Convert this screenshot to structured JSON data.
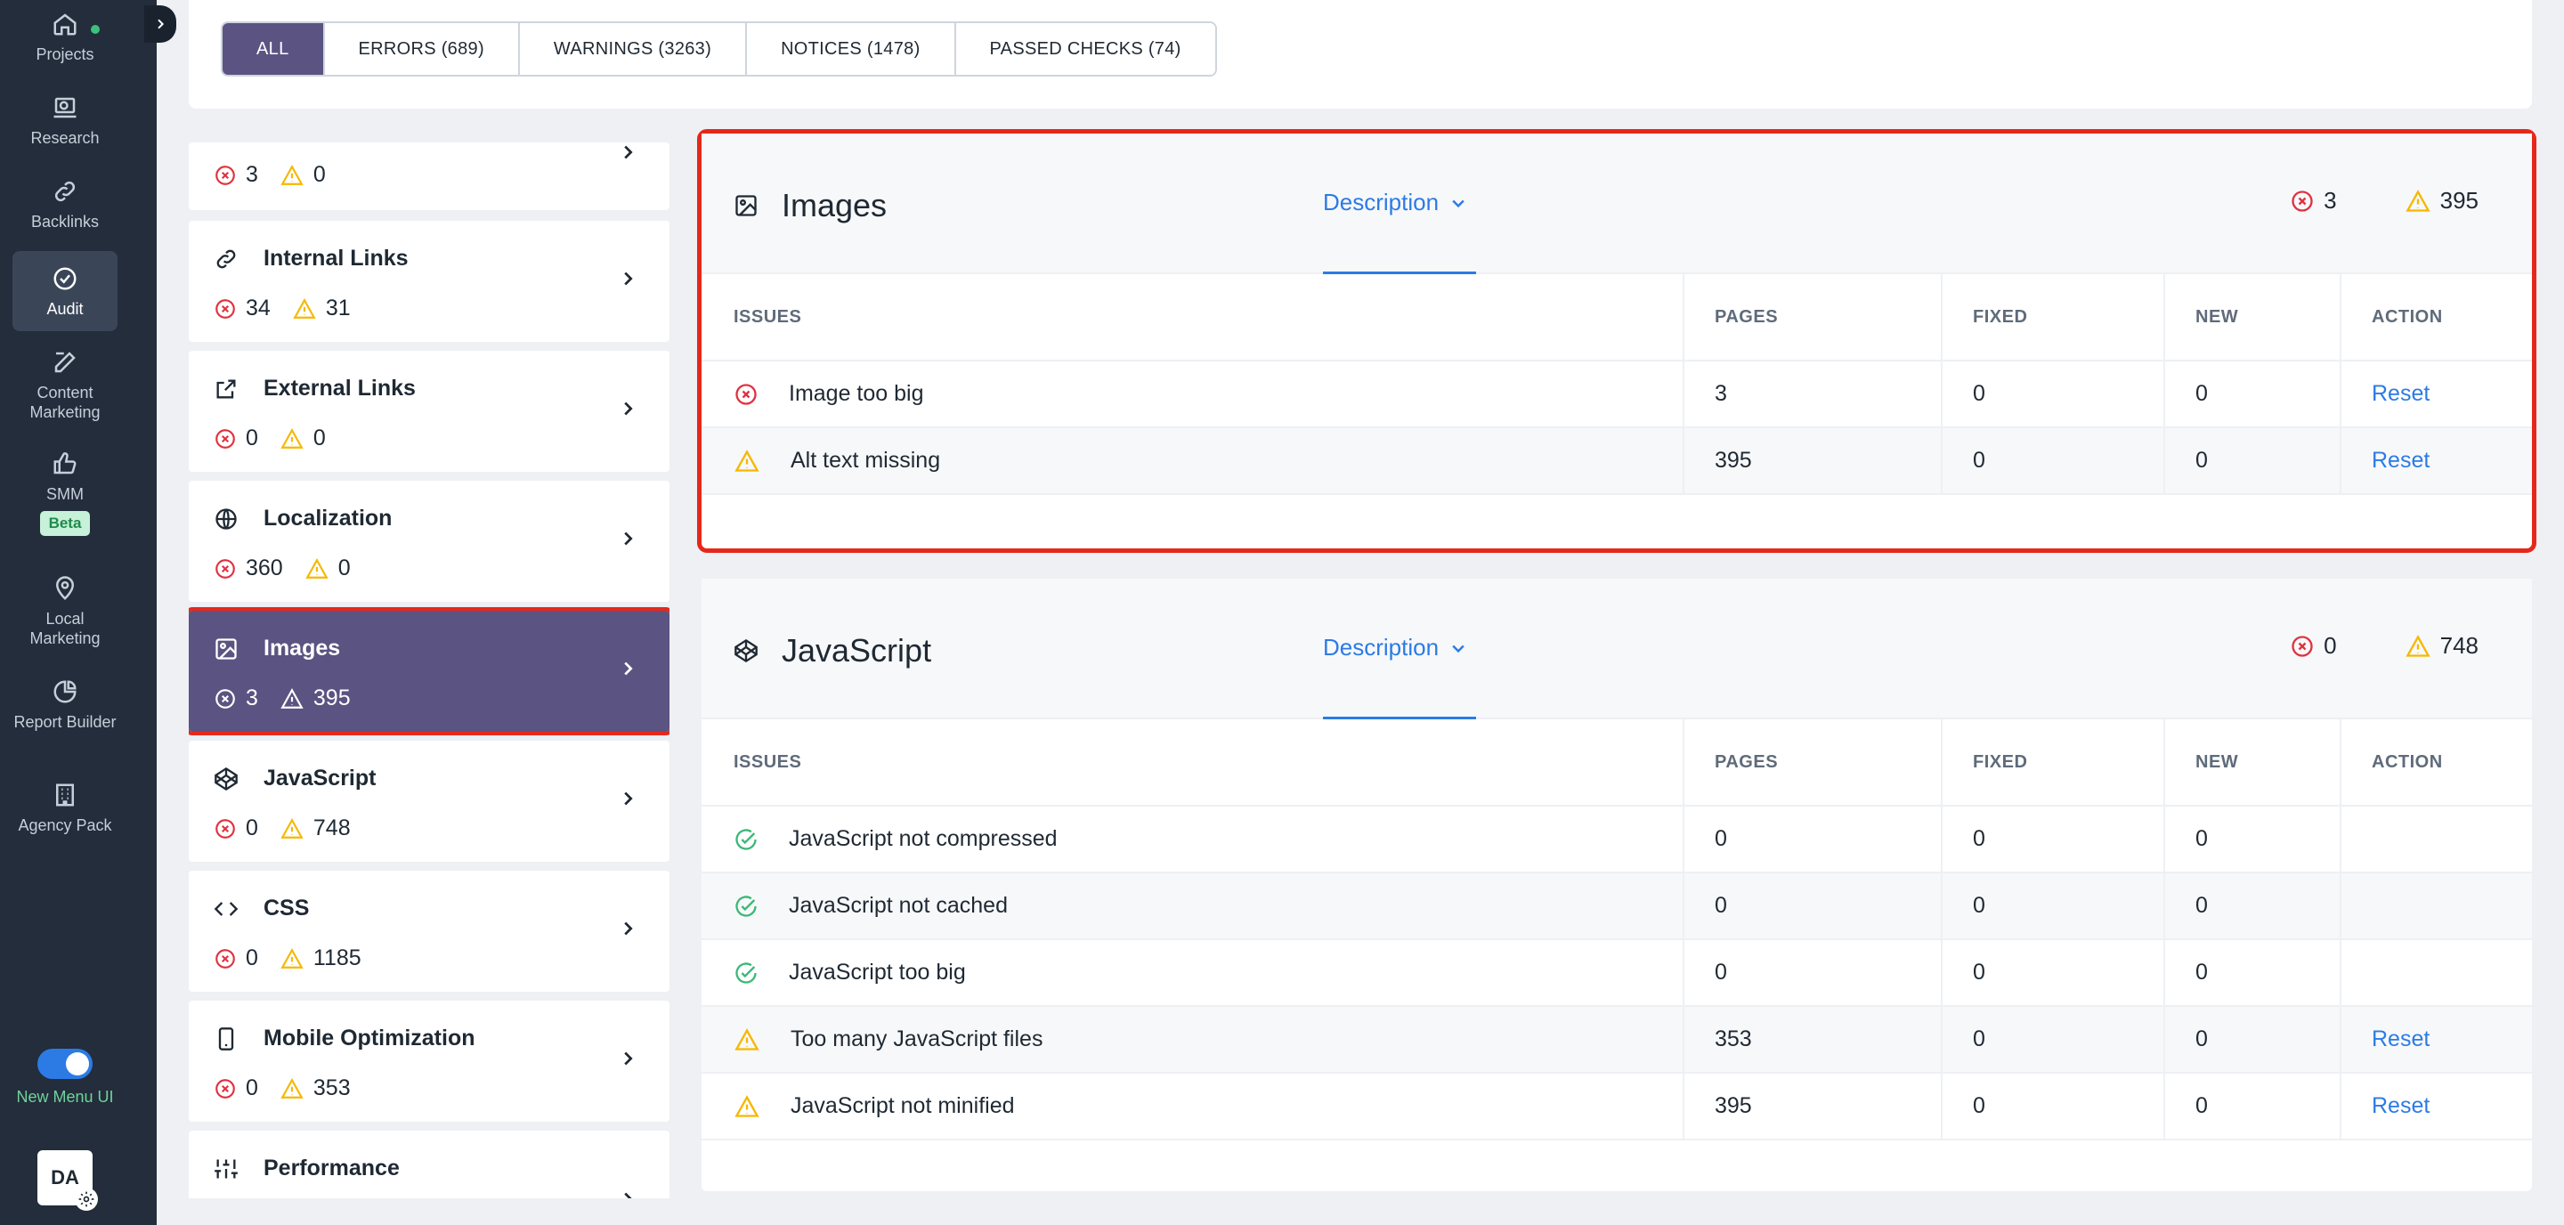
{
  "nav": {
    "items": [
      {
        "label": "Projects",
        "icon": "home-icon",
        "active": false
      },
      {
        "label": "Research",
        "icon": "laptop-search-icon",
        "active": false
      },
      {
        "label": "Backlinks",
        "icon": "link-icon",
        "active": false
      },
      {
        "label": "Audit",
        "icon": "check-circle-icon",
        "active": true
      },
      {
        "label": "Content Marketing",
        "icon": "edit-icon",
        "active": false
      },
      {
        "label": "SMM",
        "icon": "thumbs-up-icon",
        "active": false,
        "badge": "Beta"
      },
      {
        "label": "Local Marketing",
        "icon": "location-pin-icon",
        "active": false
      },
      {
        "label": "Report Builder",
        "icon": "pie-chart-icon",
        "active": false
      },
      {
        "label": "Agency Pack",
        "icon": "building-icon",
        "active": false
      }
    ],
    "toggle_label": "New Menu UI",
    "avatar": "DA"
  },
  "filters": {
    "tabs": [
      "ALL",
      "ERRORS (689)",
      "WARNINGS (3263)",
      "NOTICES (1478)",
      "PASSED CHECKS (74)"
    ],
    "active": "ALL"
  },
  "categories": [
    {
      "name": "",
      "errors": "3",
      "warnings": "0"
    },
    {
      "name": "Internal Links",
      "errors": "34",
      "warnings": "31"
    },
    {
      "name": "External Links",
      "errors": "0",
      "warnings": "0"
    },
    {
      "name": "Localization",
      "errors": "360",
      "warnings": "0"
    },
    {
      "name": "Images",
      "errors": "3",
      "warnings": "395"
    },
    {
      "name": "JavaScript",
      "errors": "0",
      "warnings": "748"
    },
    {
      "name": "CSS",
      "errors": "0",
      "warnings": "1185"
    },
    {
      "name": "Mobile Optimization",
      "errors": "0",
      "warnings": "353"
    },
    {
      "name": "Performance",
      "errors": "",
      "warnings": ""
    }
  ],
  "table_headers": {
    "issues": "ISSUES",
    "pages": "PAGES",
    "fixed": "FIXED",
    "new": "NEW",
    "action": "ACTION"
  },
  "panels": {
    "images": {
      "title": "Images",
      "description": "Description",
      "errors": "3",
      "warnings": "395",
      "rows": [
        {
          "status": "error",
          "issue": "Image too big",
          "pages": "3",
          "fixed": "0",
          "new": "0",
          "action": "Reset"
        },
        {
          "status": "warning",
          "issue": "Alt text missing",
          "pages": "395",
          "fixed": "0",
          "new": "0",
          "action": "Reset"
        }
      ]
    },
    "javascript": {
      "title": "JavaScript",
      "description": "Description",
      "errors": "0",
      "warnings": "748",
      "rows": [
        {
          "status": "passed",
          "issue": "JavaScript not compressed",
          "pages": "0",
          "fixed": "0",
          "new": "0",
          "action": ""
        },
        {
          "status": "passed",
          "issue": "JavaScript not cached",
          "pages": "0",
          "fixed": "0",
          "new": "0",
          "action": ""
        },
        {
          "status": "passed",
          "issue": "JavaScript too big",
          "pages": "0",
          "fixed": "0",
          "new": "0",
          "action": ""
        },
        {
          "status": "warning",
          "issue": "Too many JavaScript files",
          "pages": "353",
          "fixed": "0",
          "new": "0",
          "action": "Reset"
        },
        {
          "status": "warning",
          "issue": "JavaScript not minified",
          "pages": "395",
          "fixed": "0",
          "new": "0",
          "action": "Reset"
        }
      ]
    }
  },
  "colors": {
    "accent": "#5b5482",
    "link": "#2c7be5",
    "error": "#e0323f",
    "warning": "#f5b800",
    "passed": "#3cb878",
    "highlight": "#e5281b"
  }
}
